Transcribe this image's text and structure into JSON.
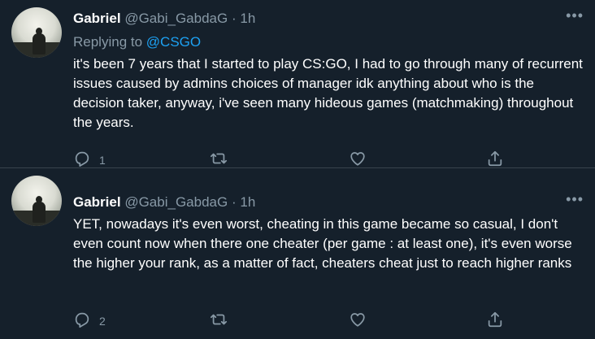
{
  "tweets": [
    {
      "author_name": "Gabriel",
      "author_handle": "@Gabi_GabdaG",
      "separator": "·",
      "time": "1h",
      "more_label": "•••",
      "replying_prefix": "Replying to ",
      "replying_to": "@CSGO",
      "text": "it's been 7 years that I started to play CS:GO, I had to go through many of recurrent issues caused by admins choices of manager idk anything about who is the decision taker, anyway, i've seen many hideous games (matchmaking) throughout the years.",
      "reply_count": "1"
    },
    {
      "author_name": "Gabriel",
      "author_handle": "@Gabi_GabdaG",
      "separator": "·",
      "time": "1h",
      "more_label": "•••",
      "text": "YET, nowadays it's even worst, cheating in this game became so casual, I don't even count now when there one cheater (per game : at least one), it's even worse the higher your rank, as a matter of fact, cheaters cheat just to reach higher ranks",
      "reply_count": "2"
    }
  ],
  "icons": [
    "reply-icon",
    "retweet-icon",
    "like-icon",
    "share-icon"
  ],
  "colors": {
    "background": "#15202b",
    "secondary_text": "#8899a6",
    "link": "#1da1f2",
    "divider": "#38444d"
  }
}
